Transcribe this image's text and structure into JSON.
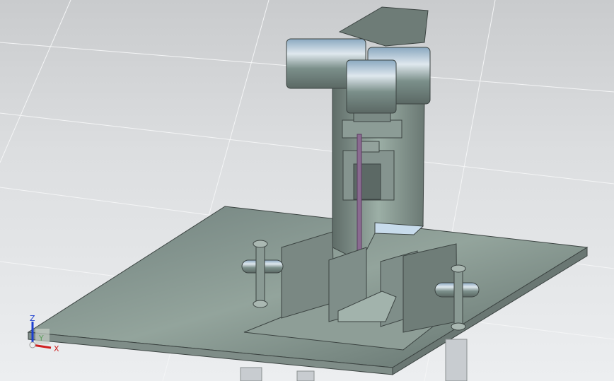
{
  "viewport": {
    "background": "#d8dadc",
    "model_color": "#7e8c86",
    "rod_color": "#8a6a90"
  },
  "triad": {
    "z_label": "Z",
    "x_label": "X",
    "y_label": "Y",
    "z_color": "#1c3fd0",
    "x_color": "#d02020",
    "y_color": "#60a060"
  }
}
